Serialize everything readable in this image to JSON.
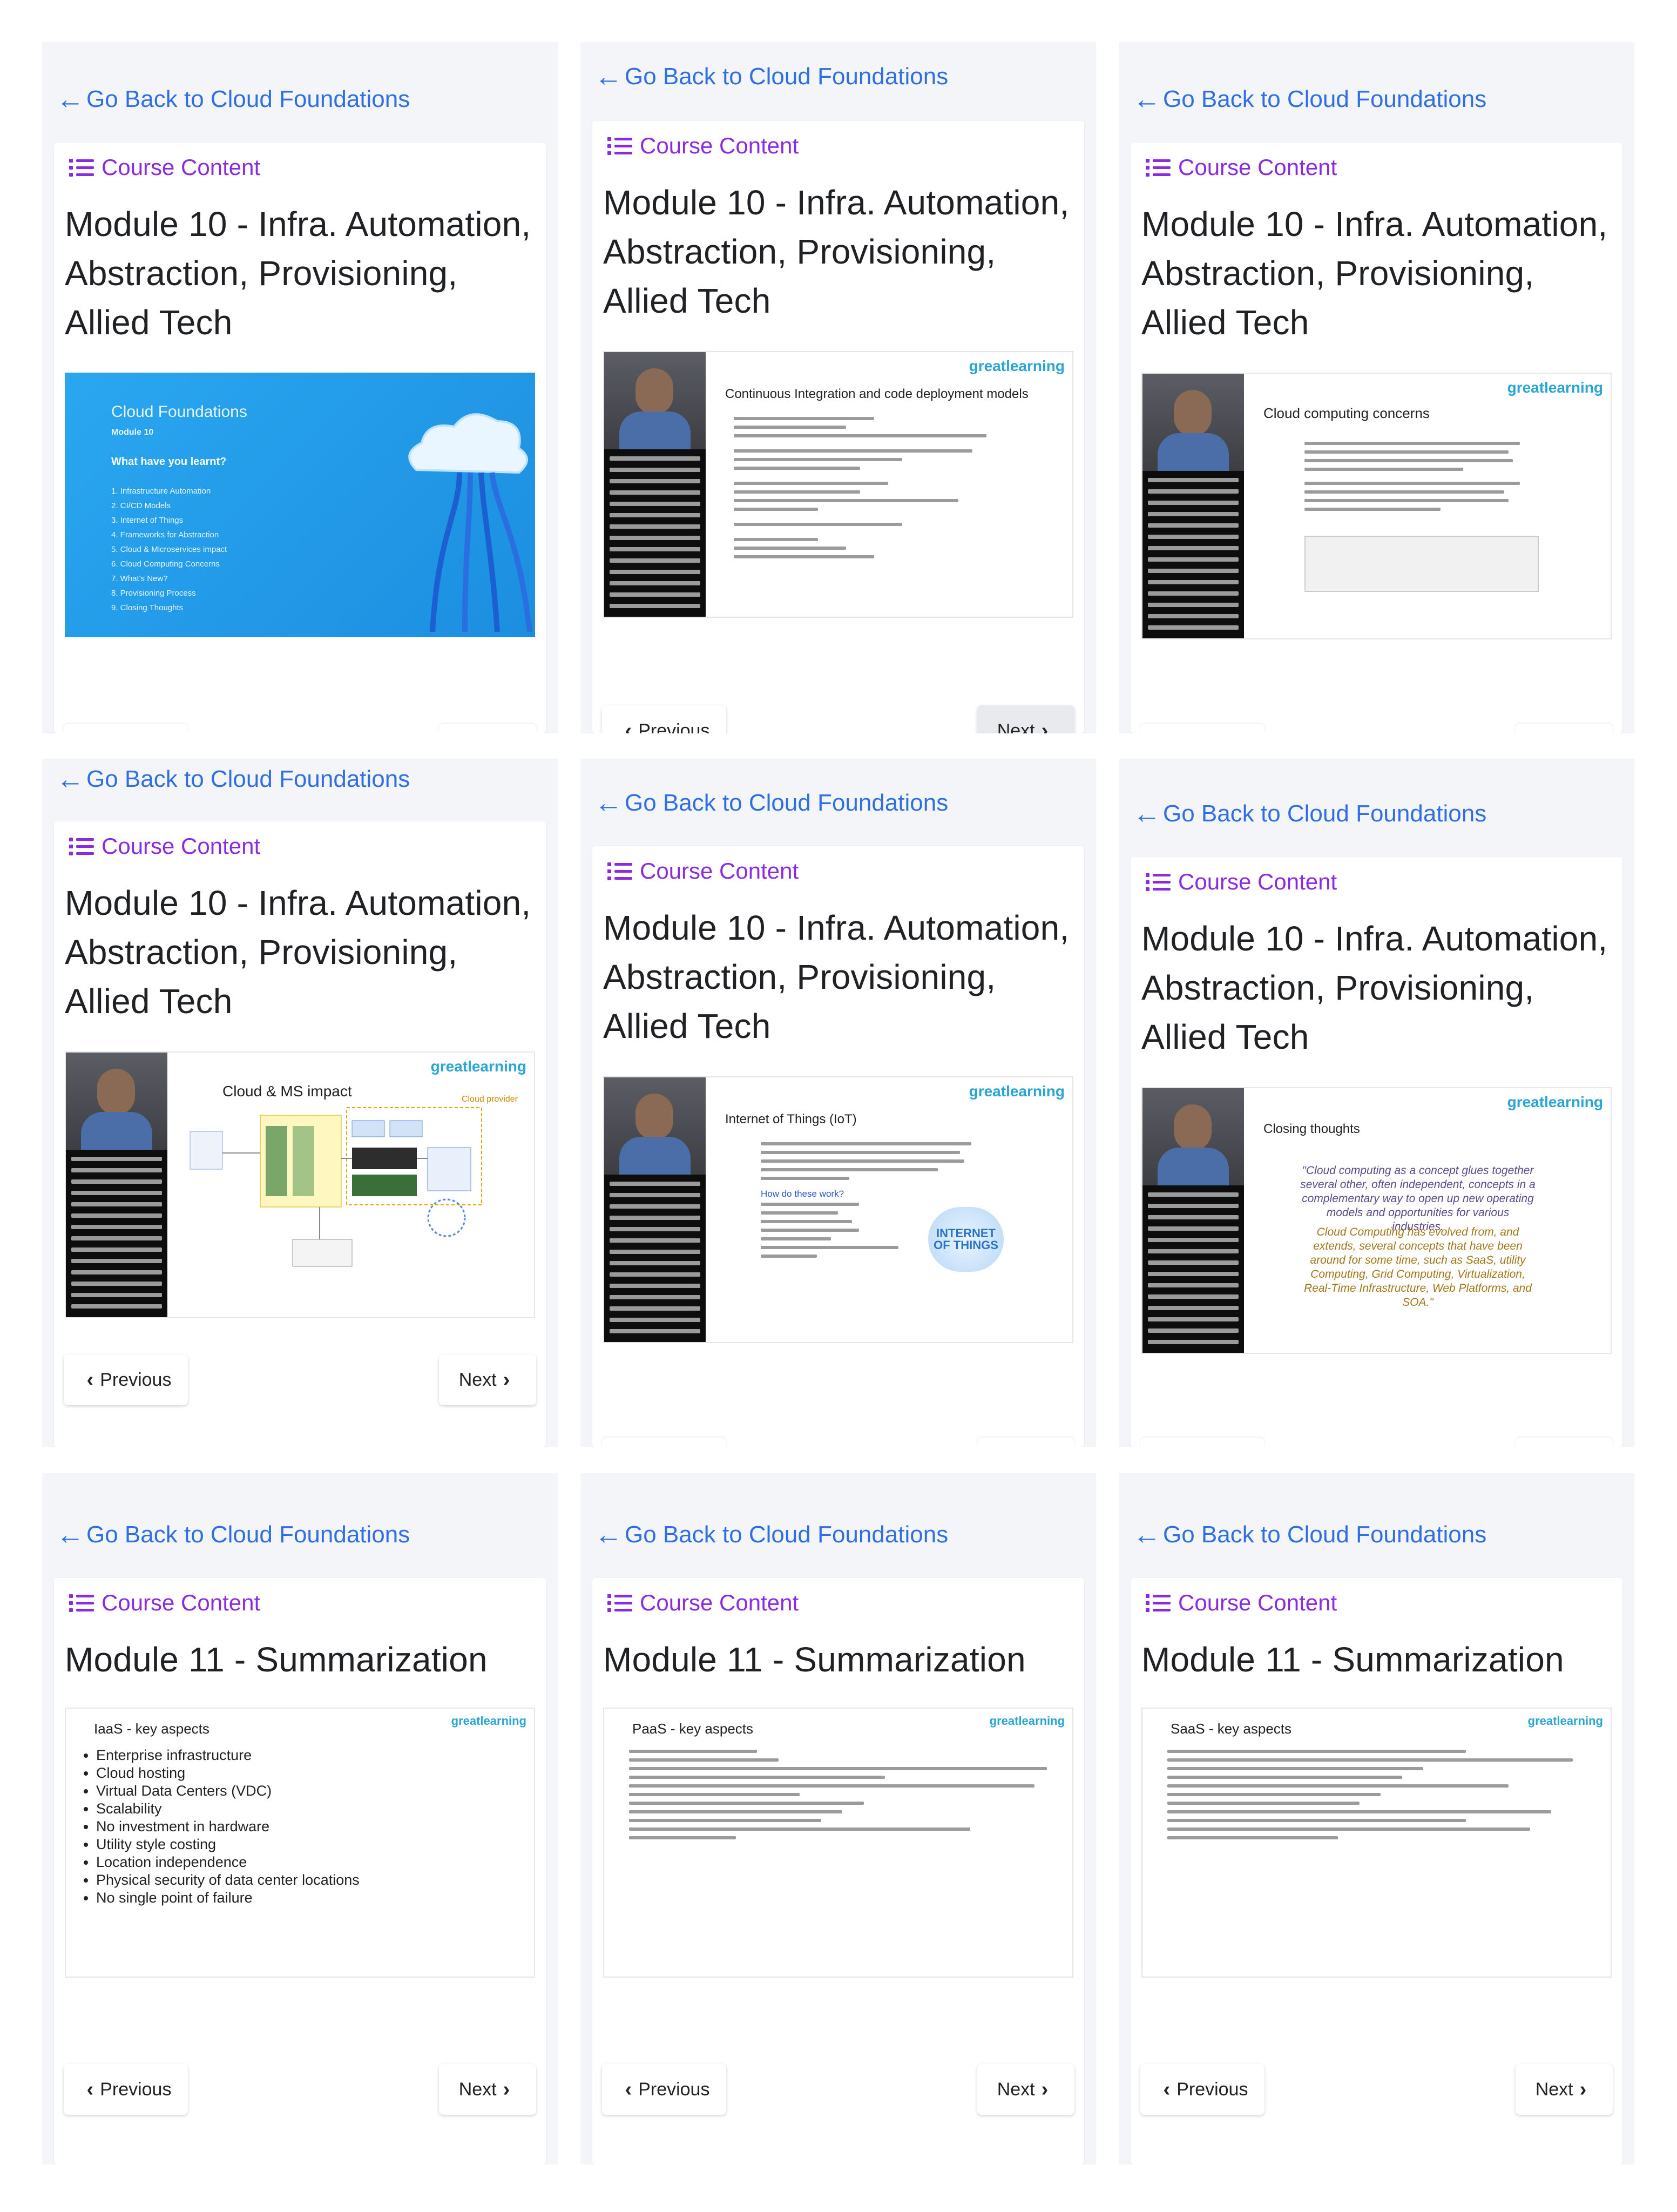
{
  "back_label": "Go Back to Cloud Foundations",
  "course_label": "Course Content",
  "module10_title": "Module 10 - Infra. Automation, Abstraction, Provisioning, Allied Tech",
  "module11_title": "Module 11 - Summarization",
  "prev_label": "Previous",
  "next_label": "Next",
  "brand": "greatlearning",
  "colors": {
    "accent": "#2f6fe3",
    "course": "#8a2be2",
    "panel_bg": "#f4f5f8"
  },
  "slides": {
    "s1": {
      "heading": "Cloud Foundations",
      "module": "Module 10",
      "question": "What have you learnt?",
      "items": [
        "1. Infrastructure Automation",
        "2. CI/CD Models",
        "3. Internet of Things",
        "4. Frameworks for Abstraction",
        "5. Cloud & Microservices impact",
        "6. Cloud Computing Concerns",
        "7. What's New?",
        "8. Provisioning Process",
        "9. Closing Thoughts"
      ]
    },
    "s2": {
      "title": "Continuous Integration and code deployment models"
    },
    "s3": {
      "title": "Cloud computing concerns"
    },
    "s4": {
      "title": "Cloud & MS impact",
      "provider": "Cloud provider"
    },
    "s5": {
      "title": "Internet of Things (IoT)",
      "q": "How do these work?",
      "badge": "INTERNET OF THINGS"
    },
    "s6": {
      "title": "Closing thoughts",
      "quote1": "\"Cloud computing as a concept glues together several other, often independent, concepts in a complementary way to open up new operating models and opportunities for various industries.",
      "quote2": "Cloud Computing has evolved from, and extends, several concepts that have been around for some time, such as SaaS, utility Computing, Grid Computing, Virtualization, Real-Time Infrastructure, Web Platforms, and SOA.\""
    },
    "s7": {
      "title": "IaaS - key aspects",
      "items": [
        "Enterprise infrastructure",
        "Cloud hosting",
        "Virtual Data Centers (VDC)",
        "Scalability",
        "No investment in hardware",
        "Utility style costing",
        "Location independence",
        "Physical security of data center locations",
        "No single point of failure"
      ]
    },
    "s8": {
      "title": "PaaS - key aspects"
    },
    "s9": {
      "title": "SaaS - key aspects"
    }
  }
}
